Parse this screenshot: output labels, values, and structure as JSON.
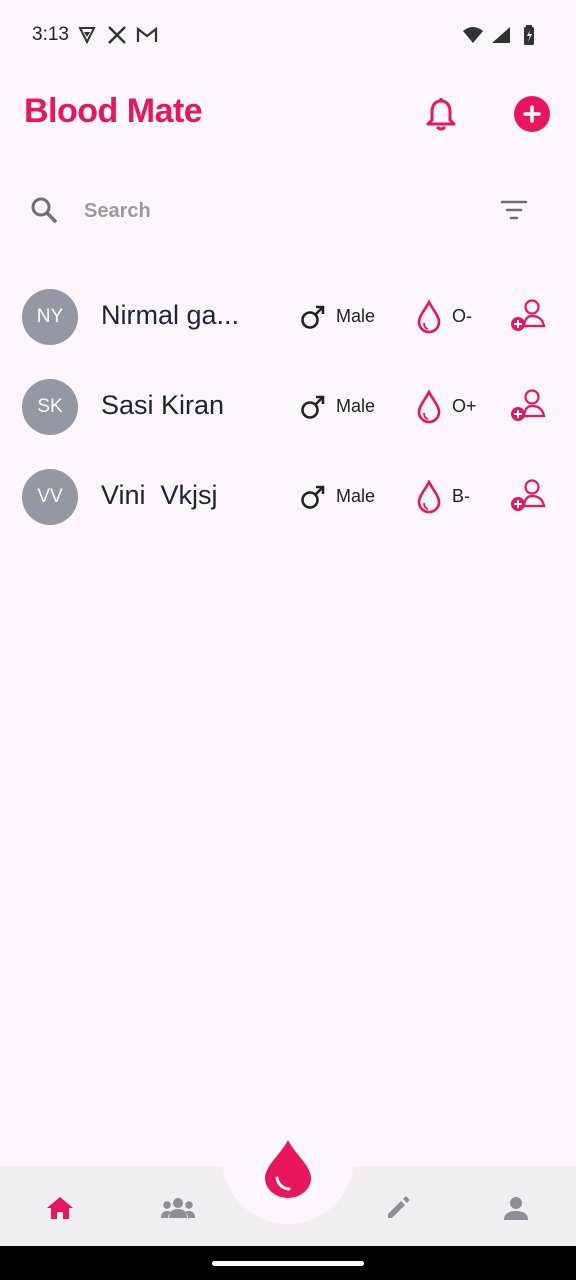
{
  "status": {
    "time": "3:13",
    "left_icons": [
      "vpn-shield-icon",
      "x-icon",
      "mail-icon"
    ],
    "right_icons": [
      "wifi-icon",
      "signal-icon",
      "battery-icon"
    ]
  },
  "header": {
    "title": "Blood Mate",
    "bell_icon": "bell-icon",
    "add_icon": "plus-circle-icon"
  },
  "search": {
    "placeholder": "Search",
    "value": ""
  },
  "colors": {
    "accent": "#e8175d",
    "avatar_bg": "#9598a4",
    "background": "#fdf6fc"
  },
  "donors": [
    {
      "initials": "NY",
      "name": "Nirmal ga...",
      "gender": "Male",
      "blood": "O-"
    },
    {
      "initials": "SK",
      "name": "Sasi Kiran",
      "gender": "Male",
      "blood": "O+"
    },
    {
      "initials": "VV",
      "name": "Vini  Vkjsj",
      "gender": "Male",
      "blood": "B-"
    }
  ],
  "nav": {
    "items": [
      "home-icon",
      "group-icon",
      "blood-drop-icon",
      "edit-icon",
      "person-icon"
    ],
    "active": "home-icon"
  }
}
